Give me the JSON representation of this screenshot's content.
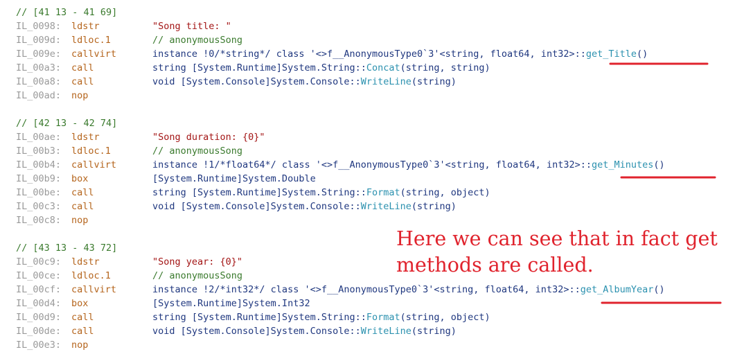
{
  "blocks": [
    {
      "comment": "// [41 13 - 41 69]",
      "instructions": [
        {
          "offset": "IL_0098:",
          "opcode": "ldstr",
          "operand": [
            [
              "str",
              "\"Song title: \""
            ]
          ]
        },
        {
          "offset": "IL_009d:",
          "opcode": "ldloc.1",
          "operand": [
            [
              "cmt",
              "// anonymousSong"
            ]
          ]
        },
        {
          "offset": "IL_009e:",
          "opcode": "callvirt",
          "operand": [
            [
              "arg",
              "instance !0/*string*/ class '<>f__AnonymousType0`3'<string, float64, int32>::"
            ],
            [
              "meth",
              "get_Title"
            ],
            [
              "arg",
              "()"
            ]
          ]
        },
        {
          "offset": "IL_00a3:",
          "opcode": "call",
          "operand": [
            [
              "arg",
              "string [System.Runtime]System.String::"
            ],
            [
              "meth",
              "Concat"
            ],
            [
              "arg",
              "(string, string)"
            ]
          ]
        },
        {
          "offset": "IL_00a8:",
          "opcode": "call",
          "operand": [
            [
              "arg",
              "void [System.Console]System.Console::"
            ],
            [
              "meth",
              "WriteLine"
            ],
            [
              "arg",
              "(string)"
            ]
          ]
        },
        {
          "offset": "IL_00ad:",
          "opcode": "nop",
          "operand": []
        }
      ]
    },
    {
      "comment": "// [42 13 - 42 74]",
      "instructions": [
        {
          "offset": "IL_00ae:",
          "opcode": "ldstr",
          "operand": [
            [
              "str",
              "\"Song duration: {0}\""
            ]
          ]
        },
        {
          "offset": "IL_00b3:",
          "opcode": "ldloc.1",
          "operand": [
            [
              "cmt",
              "// anonymousSong"
            ]
          ]
        },
        {
          "offset": "IL_00b4:",
          "opcode": "callvirt",
          "operand": [
            [
              "arg",
              "instance !1/*float64*/ class '<>f__AnonymousType0`3'<string, float64, int32>::"
            ],
            [
              "meth",
              "get_Minutes"
            ],
            [
              "arg",
              "()"
            ]
          ]
        },
        {
          "offset": "IL_00b9:",
          "opcode": "box",
          "operand": [
            [
              "arg",
              "[System.Runtime]System.Double"
            ]
          ]
        },
        {
          "offset": "IL_00be:",
          "opcode": "call",
          "operand": [
            [
              "arg",
              "string [System.Runtime]System.String::"
            ],
            [
              "meth",
              "Format"
            ],
            [
              "arg",
              "(string, object)"
            ]
          ]
        },
        {
          "offset": "IL_00c3:",
          "opcode": "call",
          "operand": [
            [
              "arg",
              "void [System.Console]System.Console::"
            ],
            [
              "meth",
              "WriteLine"
            ],
            [
              "arg",
              "(string)"
            ]
          ]
        },
        {
          "offset": "IL_00c8:",
          "opcode": "nop",
          "operand": []
        }
      ]
    },
    {
      "comment": "// [43 13 - 43 72]",
      "instructions": [
        {
          "offset": "IL_00c9:",
          "opcode": "ldstr",
          "operand": [
            [
              "str",
              "\"Song year: {0}\""
            ]
          ]
        },
        {
          "offset": "IL_00ce:",
          "opcode": "ldloc.1",
          "operand": [
            [
              "cmt",
              "// anonymousSong"
            ]
          ]
        },
        {
          "offset": "IL_00cf:",
          "opcode": "callvirt",
          "operand": [
            [
              "arg",
              "instance !2/*int32*/ class '<>f__AnonymousType0`3'<string, float64, int32>::"
            ],
            [
              "meth",
              "get_AlbumYear"
            ],
            [
              "arg",
              "()"
            ]
          ]
        },
        {
          "offset": "IL_00d4:",
          "opcode": "box",
          "operand": [
            [
              "arg",
              "[System.Runtime]System.Int32"
            ]
          ]
        },
        {
          "offset": "IL_00d9:",
          "opcode": "call",
          "operand": [
            [
              "arg",
              "string [System.Runtime]System.String::"
            ],
            [
              "meth",
              "Format"
            ],
            [
              "arg",
              "(string, object)"
            ]
          ]
        },
        {
          "offset": "IL_00de:",
          "opcode": "call",
          "operand": [
            [
              "arg",
              "void [System.Console]System.Console::"
            ],
            [
              "meth",
              "WriteLine"
            ],
            [
              "arg",
              "(string)"
            ]
          ]
        },
        {
          "offset": "IL_00e3:",
          "opcode": "nop",
          "operand": []
        }
      ]
    }
  ],
  "annotation": {
    "text": "Here we can see that in fact get methods are called.",
    "color": "#e0232d"
  },
  "colors": {
    "offset": "#9a9a9a",
    "opcode": "#b5651d",
    "string": "#a31515",
    "comment": "#3a7a2d",
    "method": "#2b91af",
    "text": "#1f377f",
    "underline": "#e0232d"
  }
}
